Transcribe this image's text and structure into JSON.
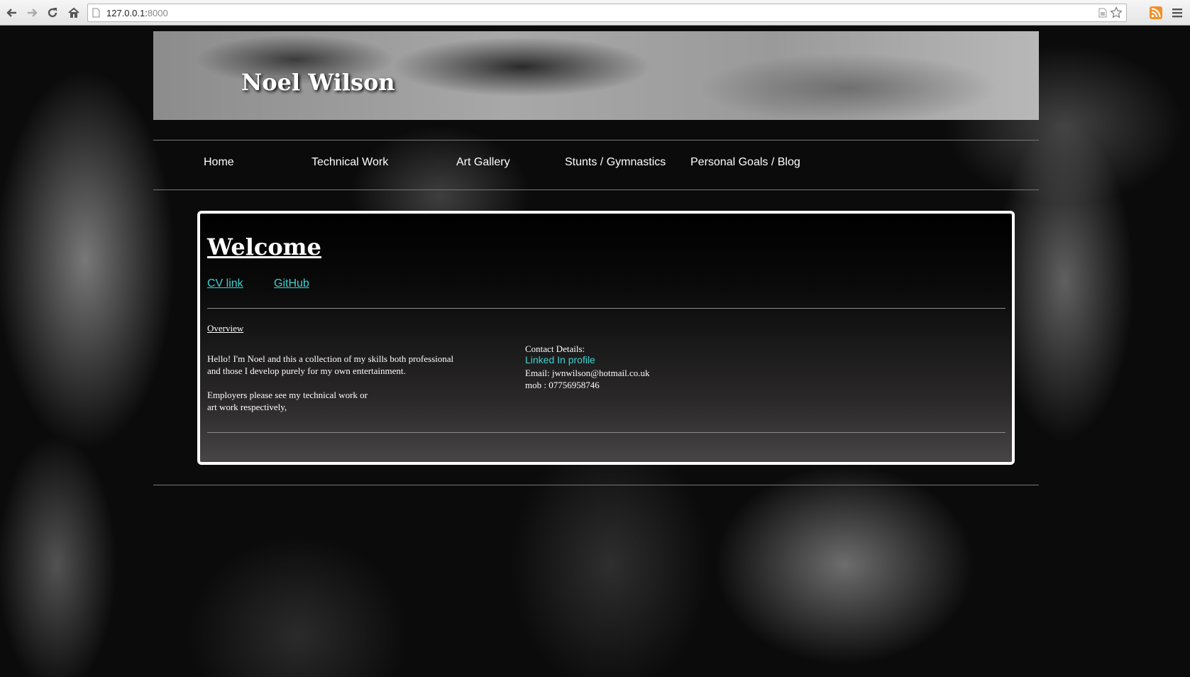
{
  "browser": {
    "url_host": "127.0.0.1:",
    "url_port": "8000",
    "icons": [
      "back-icon",
      "forward-icon",
      "reload-icon",
      "home-icon",
      "page-icon",
      "document-icon",
      "star-icon",
      "rss-icon",
      "menu-icon"
    ]
  },
  "site": {
    "title": "Noel Wilson"
  },
  "nav": {
    "items": [
      {
        "label": "Home"
      },
      {
        "label": "Technical Work"
      },
      {
        "label": "Art Gallery"
      },
      {
        "label": "Stunts / Gymnastics"
      },
      {
        "label": "Personal Goals / Blog"
      }
    ]
  },
  "main": {
    "heading": "Welcome",
    "links": [
      {
        "label": "CV link"
      },
      {
        "label": "GitHub"
      }
    ],
    "overview_label": "Overview",
    "intro_lines": [
      "Hello! I'm Noel and this a collection of my skills both professional",
      "and those I develop purely for my own entertainment."
    ],
    "employer_lines": [
      "Employers please see my technical work or",
      "art work respectively,"
    ],
    "contact": {
      "heading": "Contact Details:",
      "linkedin_label": "Linked In profile",
      "email": "Email: jwnwilson@hotmail.co.uk",
      "mobile": "mob : 07756958746"
    }
  },
  "colors": {
    "link": "#3fd2d0",
    "panel_border": "#ffffff",
    "background": "#0b0b0b"
  }
}
